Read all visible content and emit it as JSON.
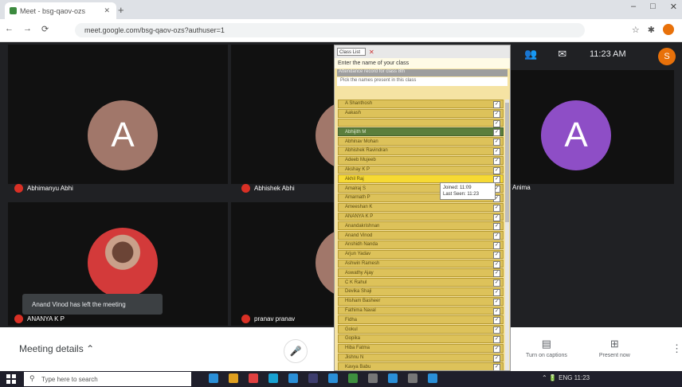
{
  "browser": {
    "tab_title": "Meet - bsg-qaov-ozs",
    "url": "meet.google.com/bsg-qaov-ozs?authuser=1",
    "new_tab": "+",
    "window_controls": [
      "–",
      "□",
      "✕"
    ],
    "nav": [
      "←",
      "→",
      "⟳"
    ],
    "addr_icons": [
      "☆",
      "✱"
    ]
  },
  "meet": {
    "time": "11:23 AM",
    "me_initial": "S",
    "participants": [
      {
        "initial": "A",
        "name": "Abhimanyu Abhi",
        "color": "#a1776a"
      },
      {
        "initial": "A",
        "name": "Abhishek Abhi",
        "color": "#a1776a"
      },
      {
        "initial": "A",
        "name": "Anima",
        "color": "#8e4ec6"
      },
      {
        "initial": "",
        "name": "ANANYA K P",
        "color": "#a1776a"
      },
      {
        "initial": "",
        "name": "pranav pranav",
        "color": "#a1776a"
      }
    ],
    "toast": "Anand Vinod has left the meeting",
    "meeting_details": "Meeting details",
    "bottom_buttons": [
      {
        "icon": "▤",
        "label": "Turn on captions"
      },
      {
        "icon": "⊞",
        "label": "Present now"
      }
    ],
    "kebab": "⋮"
  },
  "popup": {
    "header_box": "Class List",
    "class_label": "Enter the name of your class",
    "class_input": "Attendance record for class 8th",
    "hint": "Pick the names present in this class",
    "students": [
      {
        "name": "A Shanthosh",
        "style": "normal"
      },
      {
        "name": "Aakash",
        "style": "normal"
      },
      {
        "name": "",
        "style": "normal"
      },
      {
        "name": "Abhijith M",
        "style": "green"
      },
      {
        "name": "Abhinav Mohan",
        "style": "normal"
      },
      {
        "name": "Abhishek Ravindran",
        "style": "normal"
      },
      {
        "name": "Adeeb Mujeeb",
        "style": "normal"
      },
      {
        "name": "Akshay K P",
        "style": "normal"
      },
      {
        "name": "Akhil Raj",
        "style": "bright"
      },
      {
        "name": "Amalraj S",
        "style": "normal"
      },
      {
        "name": "Amarnath P",
        "style": "normal"
      },
      {
        "name": "Ameeshan K",
        "style": "normal"
      },
      {
        "name": "ANANYA K P",
        "style": "normal"
      },
      {
        "name": "Anandakrishnan",
        "style": "normal"
      },
      {
        "name": "Anand Vinod",
        "style": "normal"
      },
      {
        "name": "Anshidh Nanda",
        "style": "normal"
      },
      {
        "name": "Arjun Yadav",
        "style": "normal"
      },
      {
        "name": "Ashwin Ramesh",
        "style": "normal"
      },
      {
        "name": "Aswathy Ajay",
        "style": "normal"
      },
      {
        "name": "C K Rahul",
        "style": "normal"
      },
      {
        "name": "Devika Shaji",
        "style": "normal"
      },
      {
        "name": "Hisham Basheer",
        "style": "normal"
      },
      {
        "name": "Fathima Naval",
        "style": "normal"
      },
      {
        "name": "Fidha",
        "style": "normal"
      },
      {
        "name": "Gokul",
        "style": "normal"
      },
      {
        "name": "Gopika",
        "style": "normal"
      },
      {
        "name": "Hiba Fatma",
        "style": "normal"
      },
      {
        "name": "Jishnu N",
        "style": "normal"
      },
      {
        "name": "Kavya Babu",
        "style": "normal"
      }
    ],
    "tooltip_line1": "Joined: 11:09",
    "tooltip_line2": "Last Seen: 11:23"
  },
  "taskbar": {
    "search_placeholder": "Type here to search",
    "search_icon": "⚲",
    "apps": [
      "#2a8fd7",
      "#e0a020",
      "#e04040",
      "#18a1d2",
      "#2a8fd7",
      "#3e3e6e",
      "#2a8fd7",
      "#3e8f3e",
      "#777",
      "#2a8fd7",
      "#777",
      "#2a8fd7"
    ],
    "tray": "⌃ 🔋 ENG 11:23"
  }
}
